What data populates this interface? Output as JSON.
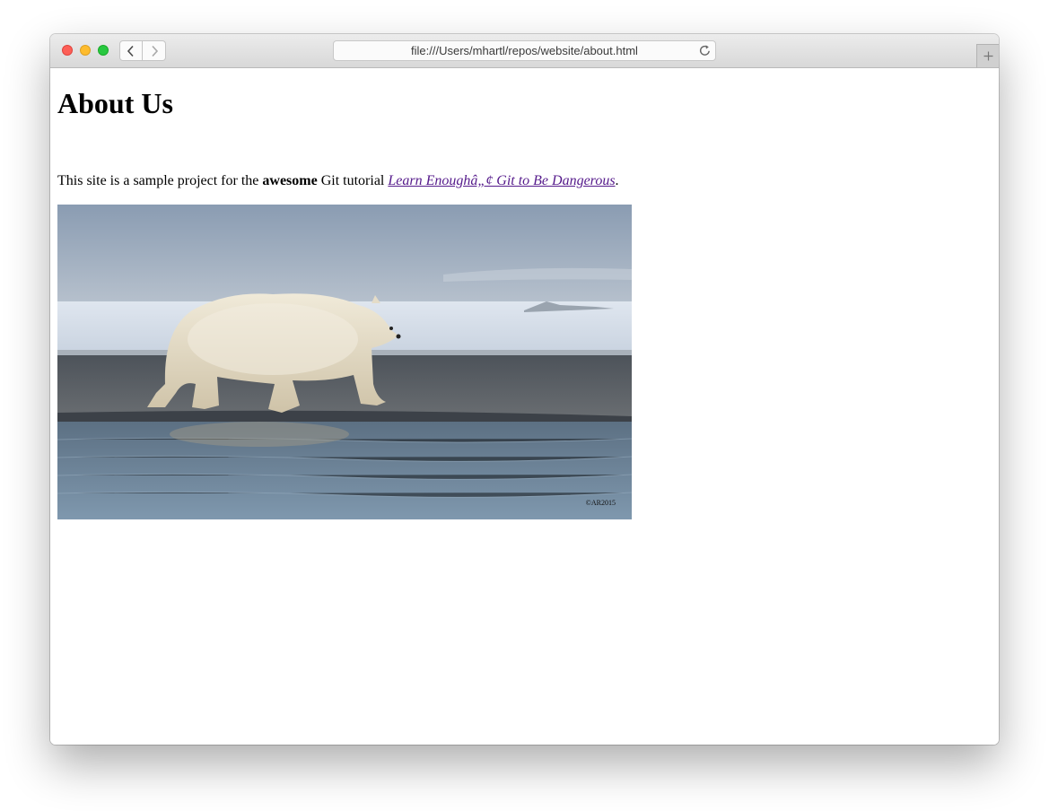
{
  "browser": {
    "url": "file:///Users/mhartl/repos/website/about.html",
    "controls": {
      "close": "close-window",
      "minimize": "minimize-window",
      "maximize": "maximize-window",
      "back_icon": "chevron-left-icon",
      "forward_icon": "chevron-right-icon",
      "reload_icon": "reload-icon",
      "new_tab_icon": "plus-icon"
    }
  },
  "page": {
    "heading": "About Us",
    "intro": {
      "before_bold": "This site is a sample project for the ",
      "bold": "awesome",
      "middle": " Git tutorial ",
      "link_text": "Learn Enoughâ„¢ Git to Be Dangerous",
      "after_link": "."
    },
    "image": {
      "subject": "polar bear walking on shoreline",
      "watermark": "©AR2015"
    }
  },
  "colors": {
    "link_visited": "#551a8b",
    "close": "#fd5f57",
    "minimize": "#febc2e",
    "maximize": "#28c840"
  }
}
